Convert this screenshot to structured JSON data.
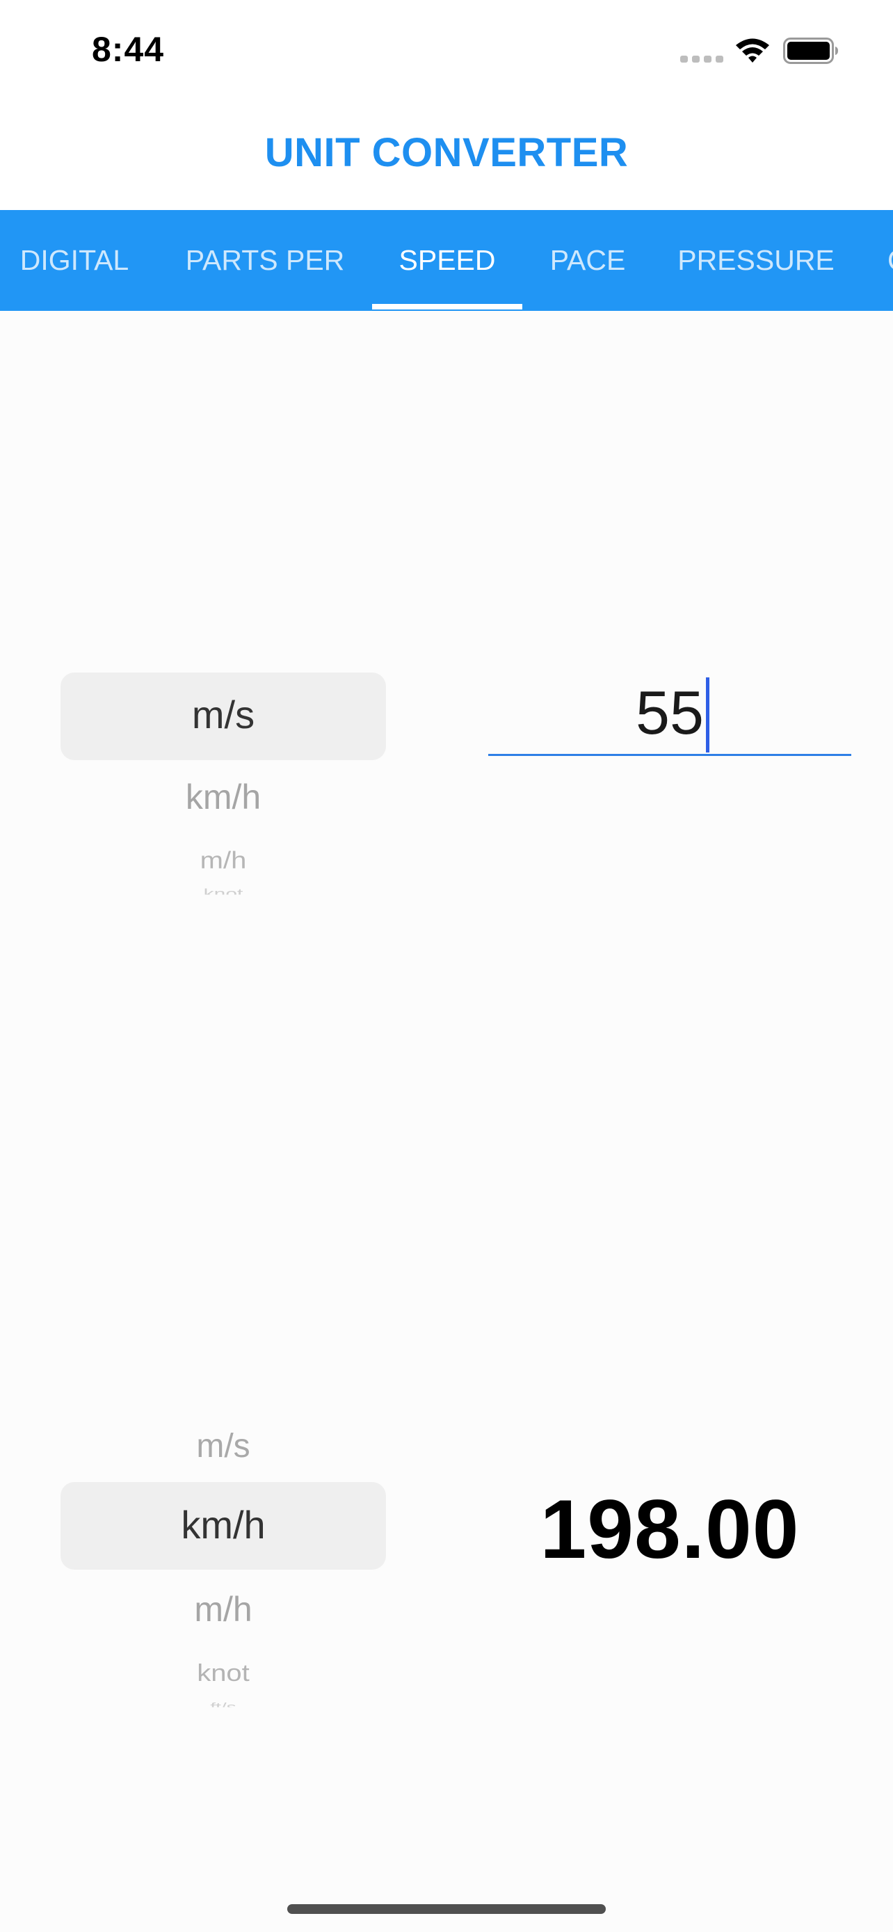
{
  "status_bar": {
    "time": "8:44",
    "icons": [
      "cellular-icon",
      "wifi-icon",
      "battery-icon"
    ]
  },
  "app": {
    "title": "UNIT CONVERTER"
  },
  "tabs": [
    {
      "label": "DIGITAL",
      "active": false
    },
    {
      "label": "PARTS PER",
      "active": false
    },
    {
      "label": "SPEED",
      "active": true
    },
    {
      "label": "PACE",
      "active": false
    },
    {
      "label": "PRESSURE",
      "active": false
    },
    {
      "label": "C",
      "active": false
    }
  ],
  "from": {
    "selected_unit": "m/s",
    "options_below": [
      "km/h",
      "m/h",
      "knot"
    ],
    "input_value": "55"
  },
  "to": {
    "option_above": "m/s",
    "selected_unit": "km/h",
    "options_below": [
      "m/h",
      "knot",
      "ft/s"
    ],
    "result_value": "198.00"
  },
  "colors": {
    "accent": "#2196f5",
    "title": "#1e8ff0",
    "picker_highlight": "#efefef"
  }
}
